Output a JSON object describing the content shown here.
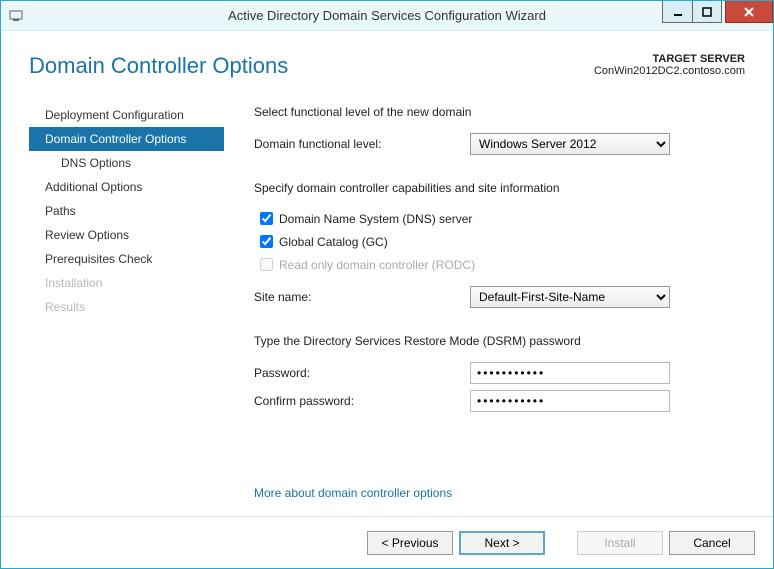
{
  "window": {
    "title": "Active Directory Domain Services Configuration Wizard"
  },
  "header": {
    "page_title": "Domain Controller Options",
    "target_label": "TARGET SERVER",
    "target_value": "ConWin2012DC2.contoso.com"
  },
  "sidebar": {
    "items": [
      {
        "label": "Deployment Configuration",
        "active": false,
        "disabled": false,
        "child": false
      },
      {
        "label": "Domain Controller Options",
        "active": true,
        "disabled": false,
        "child": false
      },
      {
        "label": "DNS Options",
        "active": false,
        "disabled": false,
        "child": true
      },
      {
        "label": "Additional Options",
        "active": false,
        "disabled": false,
        "child": false
      },
      {
        "label": "Paths",
        "active": false,
        "disabled": false,
        "child": false
      },
      {
        "label": "Review Options",
        "active": false,
        "disabled": false,
        "child": false
      },
      {
        "label": "Prerequisites Check",
        "active": false,
        "disabled": false,
        "child": false
      },
      {
        "label": "Installation",
        "active": false,
        "disabled": true,
        "child": false
      },
      {
        "label": "Results",
        "active": false,
        "disabled": true,
        "child": false
      }
    ]
  },
  "main": {
    "select_level_label": "Select functional level of the new domain",
    "domain_level_label": "Domain functional level:",
    "domain_level_value": "Windows Server 2012",
    "capabilities_label": "Specify domain controller capabilities and site information",
    "chk_dns_label": "Domain Name System (DNS) server",
    "chk_dns_checked": true,
    "chk_gc_label": "Global Catalog (GC)",
    "chk_gc_checked": true,
    "chk_rodc_label": "Read only domain controller (RODC)",
    "chk_rodc_checked": false,
    "site_label": "Site name:",
    "site_value": "Default-First-Site-Name",
    "dsrm_label": "Type the Directory Services Restore Mode (DSRM) password",
    "password_label": "Password:",
    "password_value": "•••••••••••",
    "confirm_label": "Confirm password:",
    "confirm_value": "•••••••••••",
    "more_link": "More about domain controller options"
  },
  "footer": {
    "previous": "< Previous",
    "next": "Next >",
    "install": "Install",
    "cancel": "Cancel"
  }
}
